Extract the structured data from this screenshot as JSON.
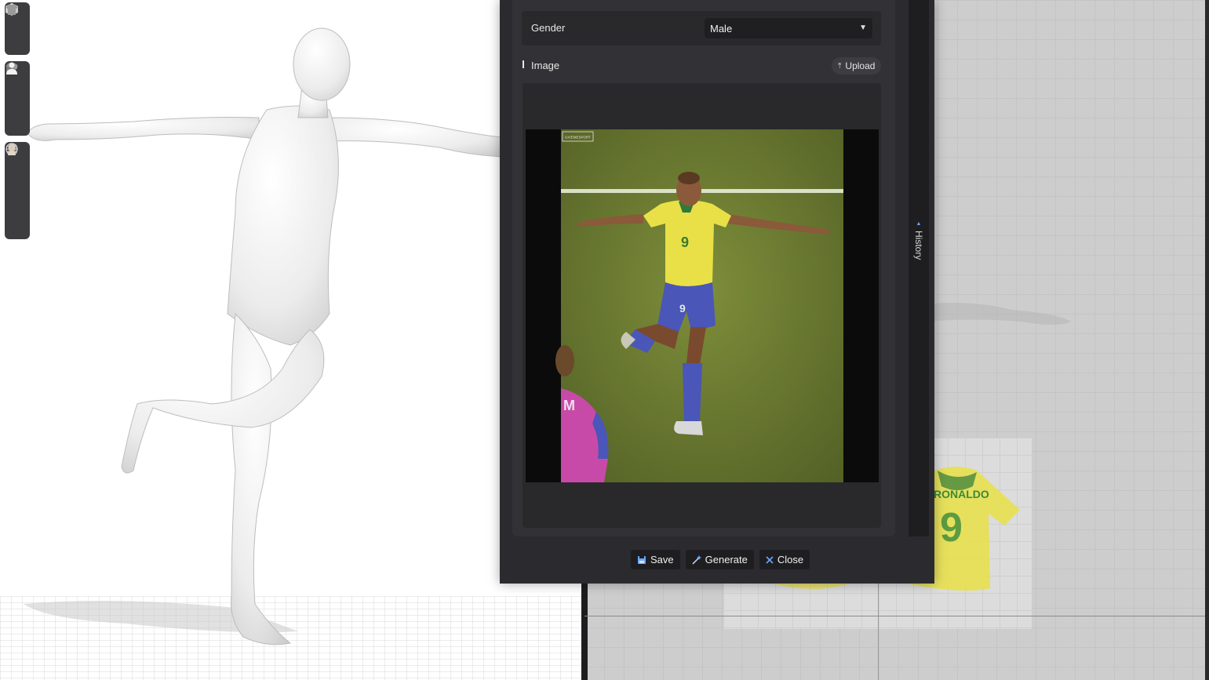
{
  "toolbar": {
    "groups": [
      {
        "tools": [
          {
            "icon": "avatar-3d-icon"
          },
          {
            "icon": "garment-icon"
          }
        ]
      },
      {
        "tools": [
          {
            "icon": "shirt-icon"
          },
          {
            "icon": "fabric-icon"
          },
          {
            "icon": "avatar-icon"
          }
        ]
      },
      {
        "tools": [
          {
            "icon": "brush-icon"
          },
          {
            "icon": "pattern-icon"
          },
          {
            "icon": "skin-icon"
          },
          {
            "icon": "globe-icon"
          }
        ]
      }
    ]
  },
  "dialog": {
    "gender": {
      "label": "Gender",
      "value": "Male"
    },
    "image_section": {
      "title": "Image",
      "upload_label": "Upload"
    },
    "image_watermark": "GIVEMESPORT",
    "history_label": "History",
    "buttons": {
      "save": "Save",
      "generate": "Generate",
      "close": "Close"
    }
  },
  "pattern_view": {
    "shirt_text": "RONALDO",
    "shirt_number": "9"
  },
  "colors": {
    "dialog_bg": "#2b2b2f",
    "panel_bg": "#323236",
    "accent_blue": "#6aa8ff",
    "jersey_yellow": "#e8e046",
    "jersey_green": "#2f7a3a",
    "shorts_blue": "#4a56b8",
    "pitch_green": "#6a7a30"
  }
}
